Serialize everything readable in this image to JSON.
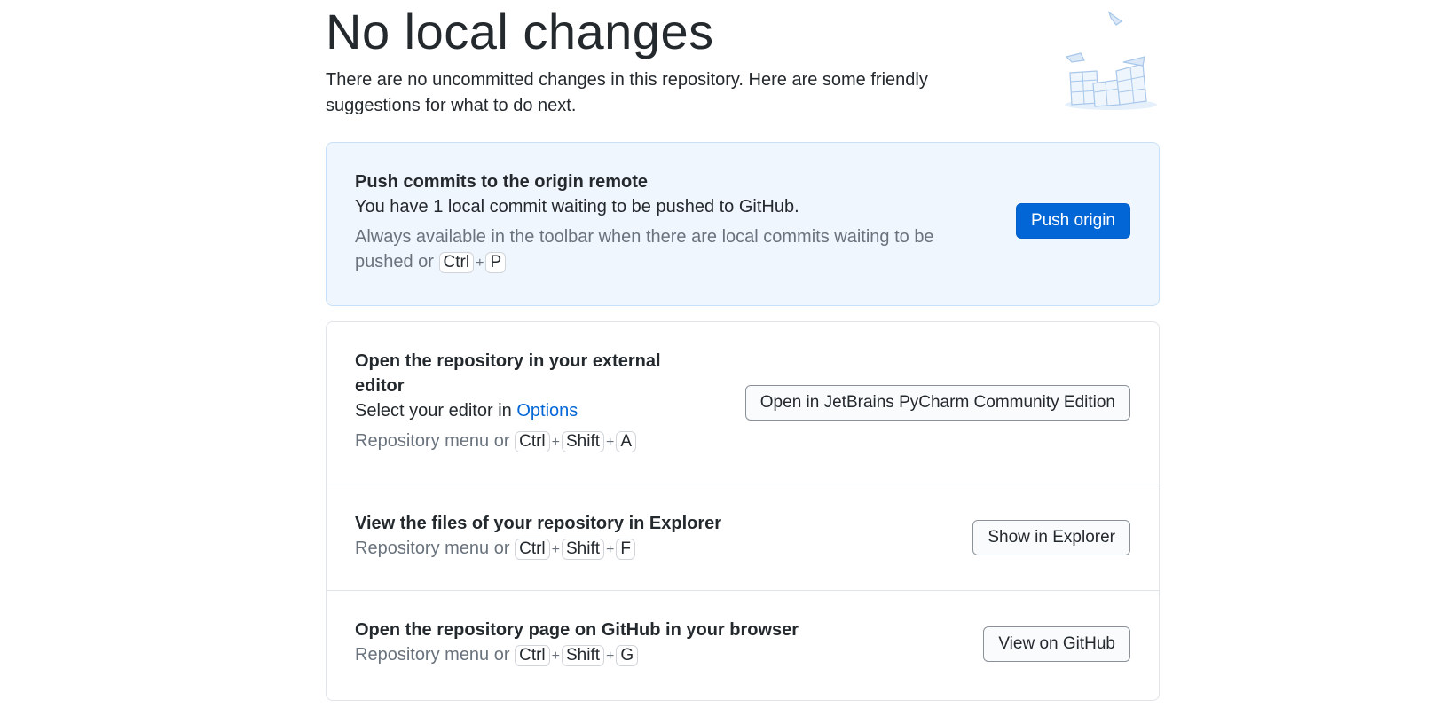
{
  "header": {
    "title": "No local changes",
    "intro": "There are no uncommitted changes in this repository. Here are some friendly suggestions for what to do next."
  },
  "push": {
    "title": "Push commits to the origin remote",
    "description": "You have 1 local commit waiting to be pushed to GitHub.",
    "hint_prefix": "Always available in the toolbar when there are local commits waiting to be pushed or",
    "keys": [
      "Ctrl",
      "P"
    ],
    "button": "Push origin"
  },
  "editor": {
    "title": "Open the repository in your external editor",
    "description_prefix": "Select your editor in",
    "options_link": "Options",
    "hint_prefix": "Repository menu or",
    "keys": [
      "Ctrl",
      "Shift",
      "A"
    ],
    "button": "Open in JetBrains PyCharm Community Edition"
  },
  "explorer": {
    "title": "View the files of your repository in Explorer",
    "hint_prefix": "Repository menu or",
    "keys": [
      "Ctrl",
      "Shift",
      "F"
    ],
    "button": "Show in Explorer"
  },
  "github": {
    "title": "Open the repository page on GitHub in your browser",
    "hint_prefix": "Repository menu or",
    "keys": [
      "Ctrl",
      "Shift",
      "G"
    ],
    "button": "View on GitHub"
  },
  "key_separator": "+",
  "colors": {
    "accent": "#0366d6",
    "push_card_bg": "#f0f6fd",
    "muted_text": "#6a737d",
    "illustration_stroke": "#a8c7ea"
  },
  "icons": {
    "illustration": "empty-repository-illustration"
  }
}
